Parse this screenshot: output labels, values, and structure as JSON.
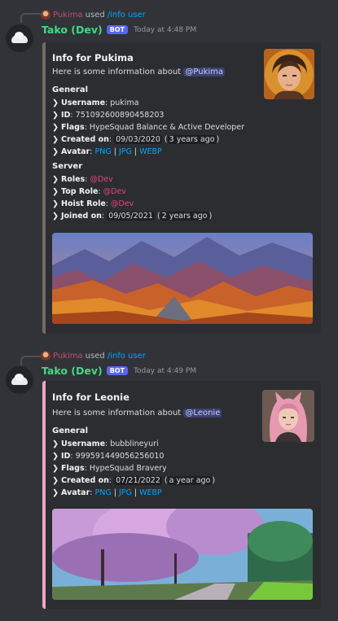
{
  "messages": [
    {
      "reply": {
        "user": "Pukima",
        "used": "used",
        "command": "/info user"
      },
      "author": {
        "name": "Tako (Dev)",
        "badge": "BOT",
        "timestamp": "Today at 4:48 PM"
      },
      "embed": {
        "title": "Info for Pukima",
        "description": "Here is some information about",
        "mention": "@Pukima",
        "general_heading": "General",
        "general": [
          {
            "label": "Username",
            "value": "pukima"
          },
          {
            "label": "ID",
            "value": "751092600890458203"
          },
          {
            "label": "Flags",
            "value": "HypeSquad Balance & Active Developer"
          },
          {
            "label": "Created on",
            "value": "09/03/2020",
            "relative": "3 years ago"
          },
          {
            "label": "Avatar",
            "links": [
              "PNG",
              "JPG",
              "WEBP"
            ]
          }
        ],
        "server_heading": "Server",
        "server": [
          {
            "label": "Roles",
            "value": "@Dev"
          },
          {
            "label": "Top Role",
            "value": "@Dev"
          },
          {
            "label": "Hoist Role",
            "value": "@Dev"
          },
          {
            "label": "Joined on",
            "value": "09/05/2021",
            "relative": "2 years ago"
          }
        ],
        "accent_color": "#756a65"
      }
    },
    {
      "reply": {
        "user": "Pukima",
        "used": "used",
        "command": "/info user"
      },
      "author": {
        "name": "Tako (Dev)",
        "badge": "BOT",
        "timestamp": "Today at 4:49 PM"
      },
      "embed": {
        "title": "Info for Leonie",
        "description": "Here is some information about",
        "mention": "@Leonie",
        "general_heading": "General",
        "general": [
          {
            "label": "Username",
            "value": "bubblineyuri"
          },
          {
            "label": "ID",
            "value": "999591449056256010"
          },
          {
            "label": "Flags",
            "value": "HypeSquad Bravery"
          },
          {
            "label": "Created on",
            "value": "07/21/2022",
            "relative": "a year ago"
          },
          {
            "label": "Avatar",
            "links": [
              "PNG",
              "JPG",
              "WEBP"
            ]
          }
        ],
        "accent_color": "#f0a3c0"
      }
    }
  ],
  "icons": {
    "chevron": "chevron-right-icon",
    "cloud": "cloud-avatar-icon"
  },
  "colors": {
    "background": "#313338",
    "embed_bg": "#2b2d31",
    "bot_badge": "#5865f2",
    "username": "#3ddc84",
    "link": "#00a8fc",
    "role": "#e5457a"
  }
}
